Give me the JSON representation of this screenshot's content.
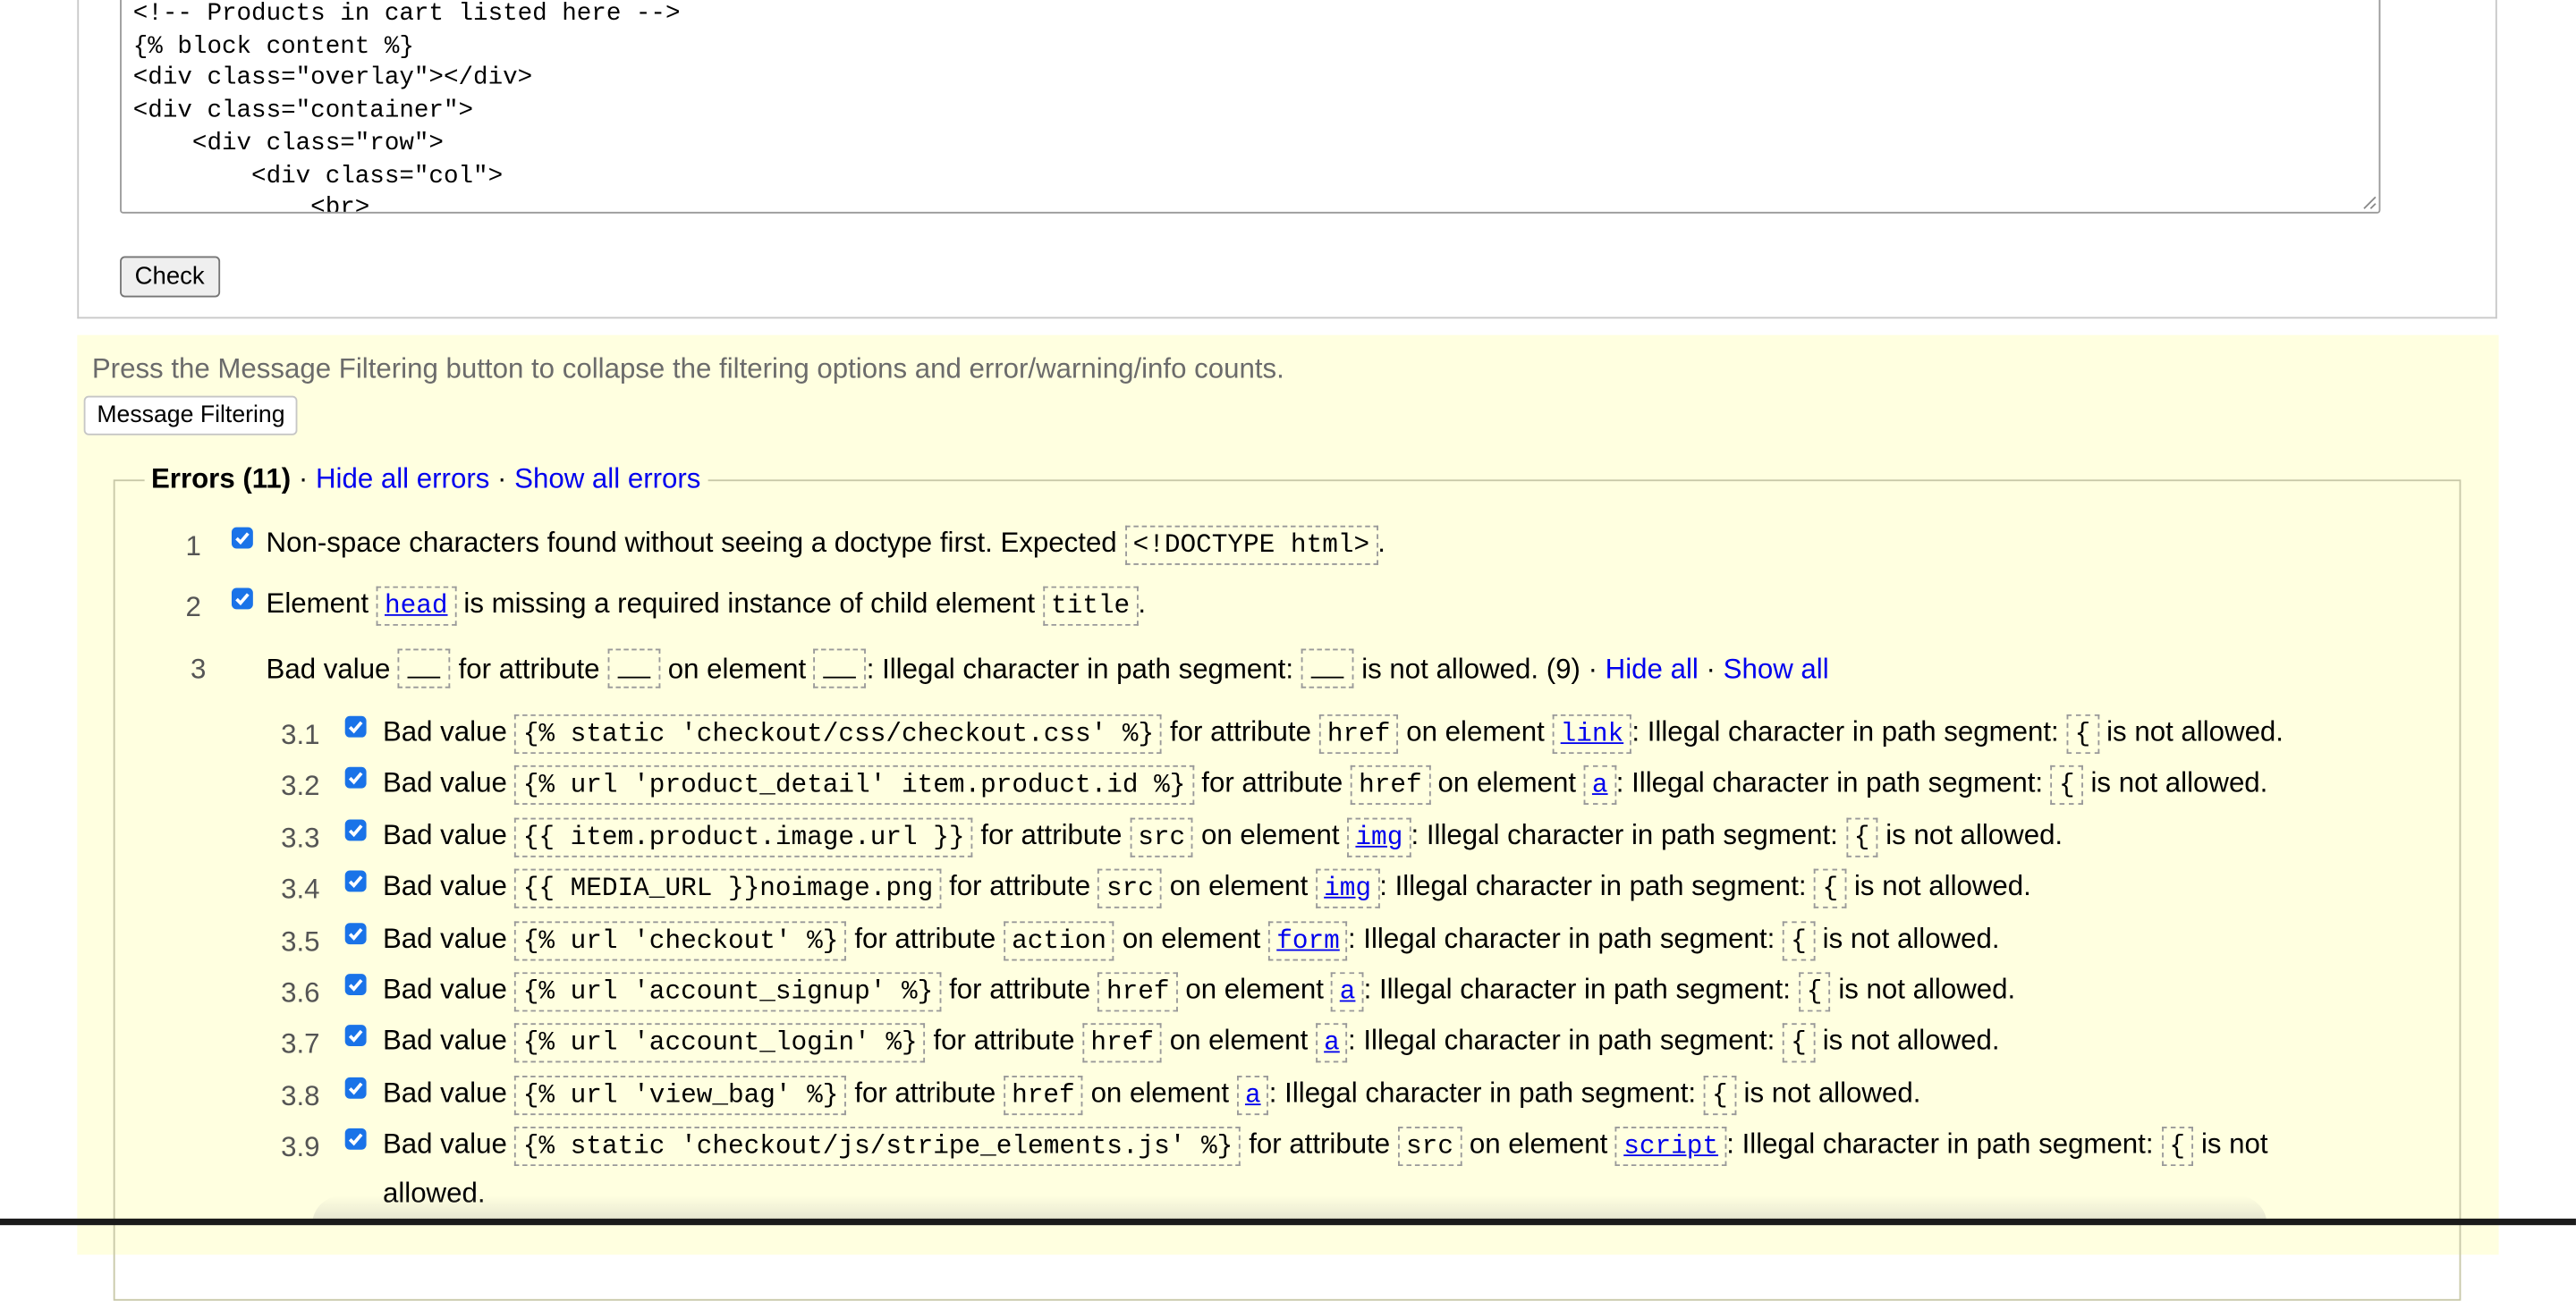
{
  "source_code": "<!-- Products in cart listed here -->\n{% block content %}\n<div class=\"overlay\"></div>\n<div class=\"container\">\n    <div class=\"row\">\n        <div class=\"col\">\n            <br>",
  "check_label": "Check",
  "filter_hint": "Press the Message Filtering button to collapse the filtering options and error/warning/info counts.",
  "filter_button_label": "Message Filtering",
  "errors": {
    "title": "Errors (11)",
    "sep": "·",
    "hide_all": "Hide all errors",
    "show_all": "Show all errors"
  },
  "error1": {
    "num": "1",
    "text": "Non-space characters found without seeing a doctype first. Expected",
    "code": "<!DOCTYPE html>",
    "end": "."
  },
  "error2": {
    "num": "2",
    "p1": "Element",
    "code1": "head",
    "p2": "is missing a required instance of child element",
    "code2": "title",
    "end": "."
  },
  "error3": {
    "num": "3",
    "p1": "Bad value",
    "p2": "for attribute",
    "p3": "on element",
    "p4": ": Illegal character in path segment:",
    "p5": "is not allowed. (9) ·",
    "hide_all": "Hide all",
    "sep": "·",
    "show_all": "Show all"
  },
  "labels": {
    "bad_value": "Bad value",
    "for_attribute": "for attribute",
    "on_element": "on element",
    "illegal": ": Illegal character in path segment:",
    "not_allowed": "is not allowed.",
    "is_not": "is not",
    "allowed": "allowed."
  },
  "sub_errors": [
    {
      "num": "3.1",
      "value": "{% static 'checkout/css/checkout.css' %}",
      "attr": "href",
      "element": "link",
      "char": "{"
    },
    {
      "num": "3.2",
      "value": "{% url 'product_detail' item.product.id %}",
      "attr": "href",
      "element": "a",
      "char": "{"
    },
    {
      "num": "3.3",
      "value": "{{ item.product.image.url }}",
      "attr": "src",
      "element": "img",
      "char": "{"
    },
    {
      "num": "3.4",
      "value": "{{ MEDIA_URL }}noimage.png",
      "attr": "src",
      "element": "img",
      "char": "{"
    },
    {
      "num": "3.5",
      "value": "{% url 'checkout' %}",
      "attr": "action",
      "element": "form",
      "char": "{"
    },
    {
      "num": "3.6",
      "value": "{% url 'account_signup' %}",
      "attr": "href",
      "element": "a",
      "char": "{"
    },
    {
      "num": "3.7",
      "value": "{% url 'account_login' %}",
      "attr": "href",
      "element": "a",
      "char": "{"
    },
    {
      "num": "3.8",
      "value": "{% url 'view_bag' %}",
      "attr": "href",
      "element": "a",
      "char": "{"
    },
    {
      "num": "3.9",
      "value": "{% static 'checkout/js/stripe_elements.js' %}",
      "attr": "src",
      "element": "script",
      "char": "{"
    }
  ],
  "colors": {
    "results_bg": "#ffffe0",
    "link": "#0000ee",
    "checkbox": "#1a73e8"
  }
}
